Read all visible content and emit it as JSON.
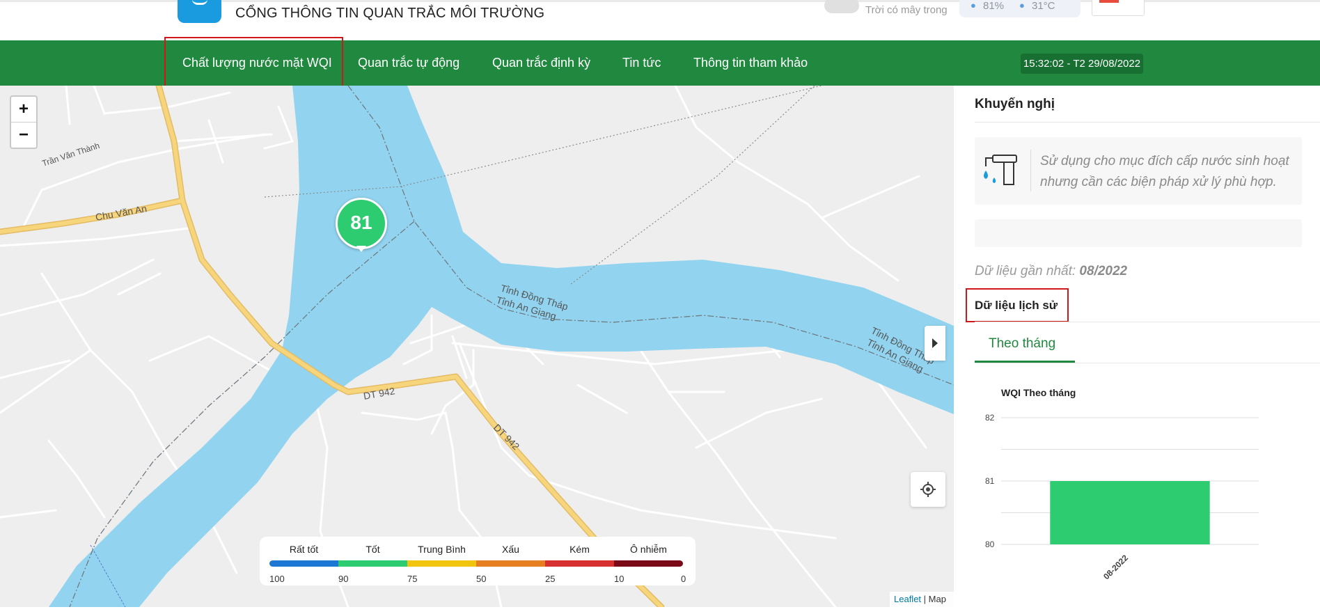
{
  "header": {
    "site_title": "CỔNG THÔNG TIN QUAN TRẮC MÔI TRƯỜNG",
    "weather_text": "Trời có mây trong",
    "humidity": "81%",
    "temperature": "31°C",
    "logo_icon": "camera-app-logo",
    "weather_toggle_icon": "cloud-icon",
    "language_flag": "vietnam-flag-icon"
  },
  "nav": {
    "items": [
      {
        "label": "Chất lượng nước mặt WQI"
      },
      {
        "label": "Quan trắc tự động"
      },
      {
        "label": "Quan trắc định kỳ"
      },
      {
        "label": "Tin tức"
      },
      {
        "label": "Thông tin tham khảo"
      }
    ],
    "clock": "15:32:02 - T2 29/08/2022"
  },
  "map": {
    "zoom_in": "+",
    "zoom_out": "−",
    "marker_value": "81",
    "labels": {
      "tran_van_thanh": "Trần Văn Thành",
      "chu_van_an": "Chu Văn An",
      "dong_thap_1": "Tỉnh Đồng Tháp",
      "an_giang_1": "Tỉnh An Giang",
      "dong_thap_2": "Tỉnh Đồng Tháp",
      "an_giang_2": "Tỉnh An Giang",
      "dt942_1": "DT 942",
      "dt942_2": "DT 942"
    },
    "attribution_link": "Leaflet",
    "attribution_rest": "| Map",
    "legend": {
      "categories": [
        {
          "label": "Rất tốt",
          "color": "#1f77d4"
        },
        {
          "label": "Tốt",
          "color": "#2ecc71"
        },
        {
          "label": "Trung Bình",
          "color": "#f1c40f"
        },
        {
          "label": "Xấu",
          "color": "#e67e22"
        },
        {
          "label": "Kém",
          "color": "#d63031"
        },
        {
          "label": "Ô nhiễm",
          "color": "#7b0a18"
        }
      ],
      "ticks": [
        "100",
        "90",
        "75",
        "50",
        "25",
        "10",
        "0"
      ]
    }
  },
  "panel": {
    "recommend_title": "Khuyến nghị",
    "recommend_text": "Sử dụng cho mục đích cấp nước sinh hoạt nhưng cần các biện pháp xử lý phù hợp.",
    "recommend_icon": "water-tap-icon",
    "latest_prefix": "Dữ liệu gần nhất:",
    "latest_value": "08/2022",
    "history_title": "Dữ liệu lịch sử",
    "tab_monthly": "Theo tháng"
  },
  "chart_data": {
    "type": "bar",
    "title": "WQI Theo tháng",
    "categories": [
      "08-2022"
    ],
    "values": [
      81
    ],
    "ylim": [
      80,
      82
    ],
    "yticks": [
      "82",
      "81",
      "80"
    ],
    "bar_color": "#2ecc71",
    "grid": true
  }
}
